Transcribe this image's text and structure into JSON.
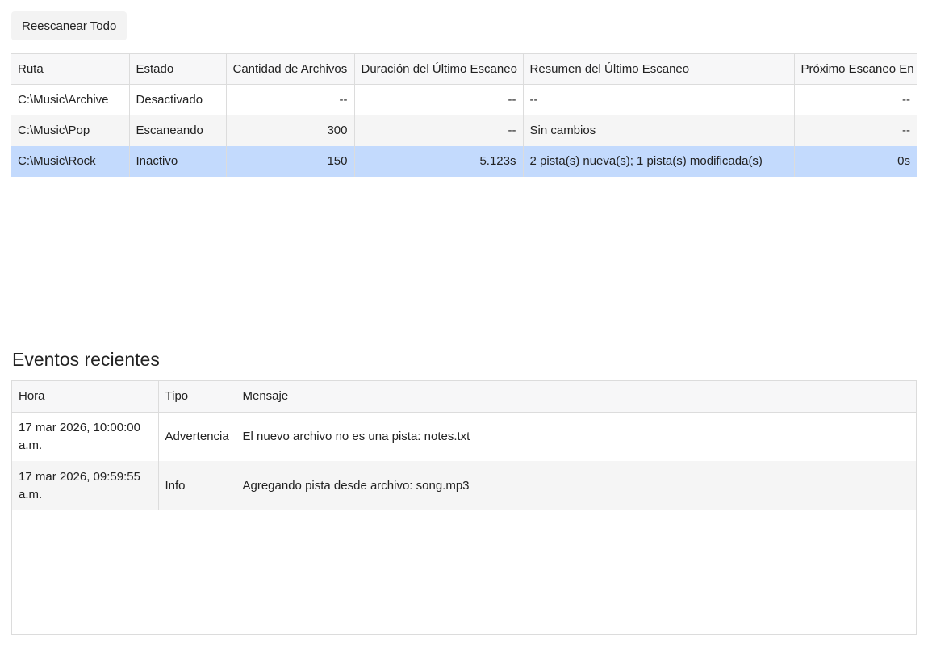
{
  "toolbar": {
    "rescan_all_label": "Reescanear Todo"
  },
  "folders_table": {
    "columns": [
      "Ruta",
      "Estado",
      "Cantidad de Archivos",
      "Duración del Último Escaneo",
      "Resumen del Último Escaneo",
      "Próximo Escaneo En"
    ],
    "rows": [
      {
        "path": "C:\\Music\\Archive",
        "status": "Desactivado",
        "file_count": "--",
        "last_scan_duration": "--",
        "last_scan_summary": "--",
        "next_scan_in": "--"
      },
      {
        "path": "C:\\Music\\Pop",
        "status": "Escaneando",
        "file_count": "300",
        "last_scan_duration": "--",
        "last_scan_summary": "Sin cambios",
        "next_scan_in": "--"
      },
      {
        "path": "C:\\Music\\Rock",
        "status": "Inactivo",
        "file_count": "150",
        "last_scan_duration": "5.123s",
        "last_scan_summary": "2 pista(s) nueva(s); 1 pista(s) modificada(s)",
        "next_scan_in": "0s"
      }
    ],
    "selected_row_color": "#c3dafd"
  },
  "events_section": {
    "title": "Eventos recientes",
    "columns": [
      "Hora",
      "Tipo",
      "Mensaje"
    ],
    "rows": [
      {
        "time": "17 mar 2026, 10:00:00 a.m.",
        "type": "Advertencia",
        "message": "El nuevo archivo no es una pista: notes.txt"
      },
      {
        "time": "17 mar 2026, 09:59:55 a.m.",
        "type": "Info",
        "message": "Agregando pista desde archivo: song.mp3"
      }
    ]
  }
}
